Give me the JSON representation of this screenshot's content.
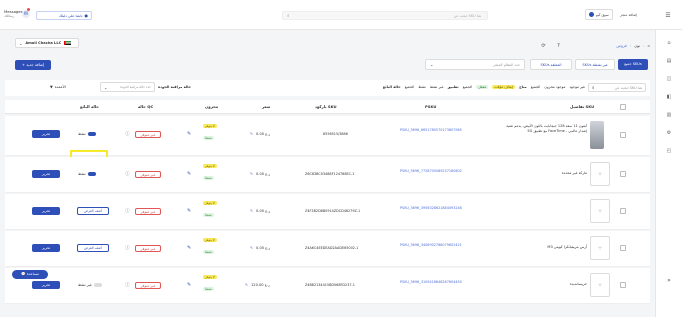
{
  "topbar": {
    "messages_label": "Messages",
    "messages_sub": "رسائلك",
    "follow_label": "تابعنا علي دليلك",
    "search_placeholder": "ابحث عن SKU هنا",
    "account_label": "سوق كيو",
    "store_label": "إضافة متجر"
  },
  "sidebar": {
    "items": [
      "الرئيسية",
      "المنتجات",
      "الطلبات",
      "المخزون",
      "التقارير",
      "الإعدادات"
    ]
  },
  "breadcrumb": {
    "home": "الرئيسية",
    "mid": "نون",
    "current": "فروض"
  },
  "store": {
    "name": "Amoli Chacha LLC",
    "add_button": "+ إضافة جديد"
  },
  "tabs": {
    "all": "جميع SKUs",
    "active": "SKUs غير نشطة",
    "pending": "SKUs المعلقة",
    "filter_placeholder": "حدد النظام المتجر"
  },
  "filters": {
    "search_placeholder": "ابحث عن SKU هنا",
    "chips": [
      "حالة البائع",
      "الجميع",
      "نشط",
      "غير نشط",
      "تطبيق",
      "الجميع",
      "مفعل",
      "إيقاف مؤقت",
      "متاح",
      "الجميع",
      "موجود مخزون",
      "غير موجود"
    ],
    "quality_label": "حالة مراقبة الجودة",
    "quality_placeholder": "حدد حالة مراقبة الجودة",
    "columns_btn": "الأعمدة"
  },
  "table": {
    "headers": [
      "تفاصيل SKU",
      "PSKU",
      "باركود SKU",
      "سعر",
      "مخزون",
      "حالة QC",
      "حالة البائع"
    ],
    "rows": [
      {
        "name": "آيفون 11 سعة 128 جيجابايت باللون الأبيض، يدعم تقنية 5G مع تطبيق FaceTime - إصدار عالمي",
        "psku": "PSKU_3696_6651780570173807965",
        "barcode": "8556515/3886",
        "price": "0.00 ر.ع",
        "stock_a": "لا يتوفر",
        "stock_b": "نشط",
        "qc": "غير متوفر",
        "status": "نشط",
        "action": "تحرير",
        "extra": ""
      },
      {
        "name": "ماركة غير محددة",
        "psku": "PSKU_3696_7728705089237180602",
        "barcode": "Z6C83BC03488F124788EC-1",
        "price": "0.00 ر.ع",
        "stock_a": "لا يتوفر",
        "stock_b": "نشط",
        "qc": "غير متوفر",
        "status": "نشط",
        "action": "تحرير",
        "extra": ""
      },
      {
        "name": "",
        "psku": "PSKU_3696_3956328621884093248",
        "barcode": "Z4F3B2D8B0914ZDCD46279Z-1",
        "price": "0.00 ر.ع",
        "stock_a": "لا يتوفر",
        "stock_b": "نشط",
        "qc": "غير متوفر",
        "status": "",
        "action": "تحرير",
        "extra": "أضف العرض"
      },
      {
        "name": "M3 أرس بتريفيانكزا كويتي",
        "psku": "PSKU_3696_3408902768079602421",
        "barcode": "Z4A6C4EEDEAD2AADE65002-1",
        "price": "0.00 ر.ع",
        "stock_a": "لا يتوفر",
        "stock_b": "نشط",
        "qc": "غير متوفر",
        "status": "",
        "action": "تحرير",
        "extra": "أضف العرض"
      },
      {
        "name": "خريسانديدة",
        "psku": "PSKU_3696_3109418648267604450",
        "barcode": "Z4B82134415BD068FD237-1",
        "price": "120.00 ر.ع",
        "stock_a": "لا يتوفر",
        "stock_b": "نشط",
        "qc": "غير متوفر",
        "status": "غير نشط",
        "action": "تحرير",
        "extra": ""
      }
    ]
  },
  "help_button": "مساعدة",
  "colors": {
    "primary": "#2f4fb8",
    "danger": "#e05555",
    "warning": "#f6e85a",
    "success": "#2f8a3c"
  }
}
